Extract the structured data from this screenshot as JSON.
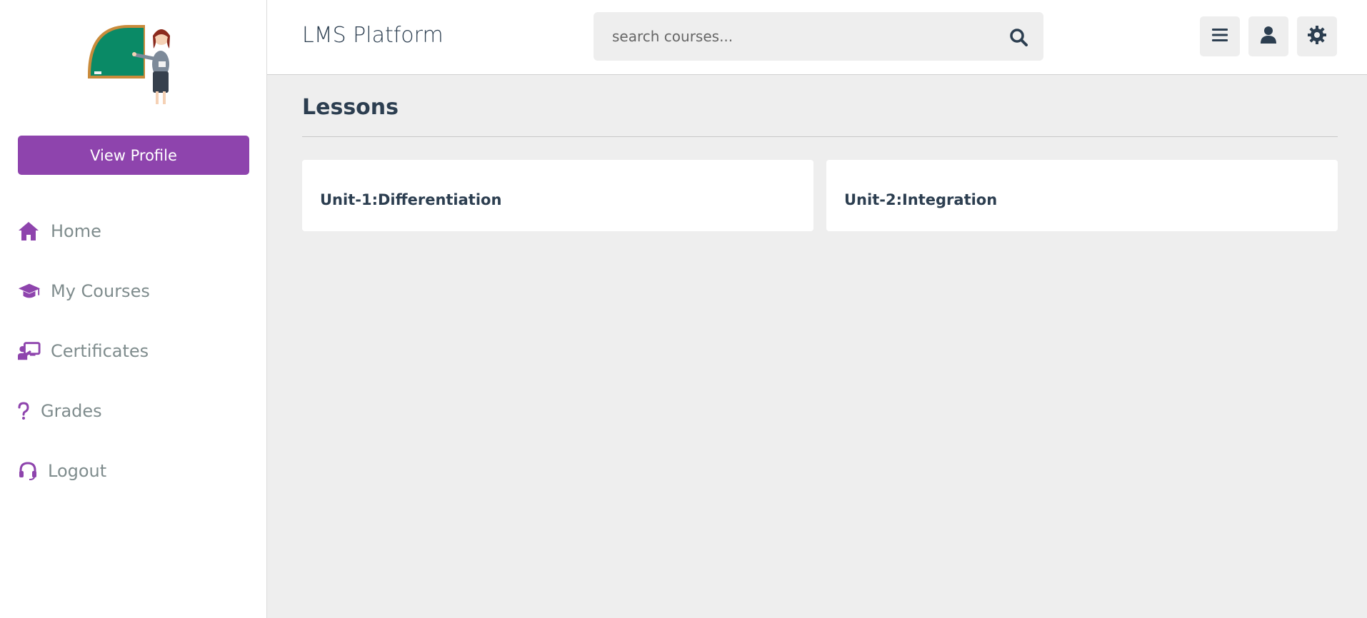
{
  "sidebar": {
    "profile_button": "View Profile",
    "items": [
      {
        "label": "Home",
        "icon": "home-icon"
      },
      {
        "label": "My Courses",
        "icon": "graduation-cap-icon"
      },
      {
        "label": "Certificates",
        "icon": "chalkboard-teacher-icon"
      },
      {
        "label": "Grades",
        "icon": "question-icon"
      },
      {
        "label": "Logout",
        "icon": "headset-icon"
      }
    ],
    "accent_color": "#8e44ad"
  },
  "header": {
    "brand": "LMS Platform",
    "search_placeholder": "search courses...",
    "buttons": [
      "menu-icon",
      "user-icon",
      "gear-icon"
    ]
  },
  "main": {
    "title": "Lessons",
    "lessons": [
      {
        "title": "Unit-1:Differentiation"
      },
      {
        "title": "Unit-2:Integration"
      }
    ]
  }
}
